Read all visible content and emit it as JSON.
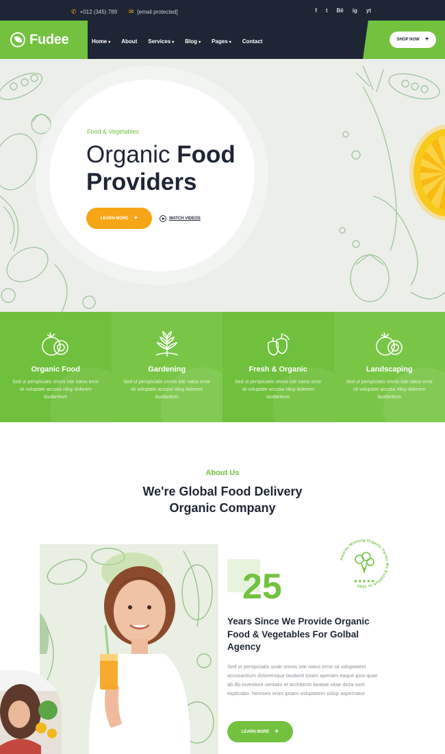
{
  "topbar": {
    "phone": "+012 (345) 789",
    "email": "[email protected]",
    "social": [
      "f",
      "t",
      "Bē",
      "ig",
      "yt"
    ]
  },
  "brand": {
    "name": "Fudee"
  },
  "nav": {
    "items": [
      {
        "label": "Home",
        "dropdown": true
      },
      {
        "label": "About",
        "dropdown": false
      },
      {
        "label": "Services",
        "dropdown": true
      },
      {
        "label": "Blog",
        "dropdown": true
      },
      {
        "label": "Pages",
        "dropdown": true
      },
      {
        "label": "Contact",
        "dropdown": false
      }
    ],
    "shop_label": "SHOP NOW"
  },
  "hero": {
    "subtitle": "Food & Vegetables",
    "title_light": "Organic ",
    "title_bold_1": "Food",
    "title_bold_2": "Providers",
    "learn_label": "LEARN MORE",
    "watch_label": "WATCH VIDEOS"
  },
  "features": [
    {
      "title": "Organic Food",
      "desc": "Sed ut perspiciatis omnis iste natus error sit voluptate accusa ntiuy dolorem laudantium",
      "icon": "tomato-icon"
    },
    {
      "title": "Gardening",
      "desc": "Sed ut perspiciatis omnis iste natus error sit voluptate accusa ntiuy dolorem laudantium",
      "icon": "wheat-icon"
    },
    {
      "title": "Fresh & Organic",
      "desc": "Sed ut perspiciatis omnis iste natus error sit voluptate accusa ntiuy dolorem laudantium",
      "icon": "pepper-icon"
    },
    {
      "title": "Landscaping",
      "desc": "Sed ut perspiciatis omnis iste natus error sit voluptate accusa ntiuy dolorem laudantium",
      "icon": "tomato-icon"
    }
  ],
  "about": {
    "label": "About Us",
    "title_line1": "We're Global Food Delivery",
    "title_line2": "Organic Company",
    "years_number": "25",
    "years_title": "Years Since We Provide Organic Food & Vegetables For Golbal Agency",
    "text": "Sed ut perspiciatis unde omnis iste natus error sit voluptatem accusantium doloremque laudanti totam aperiam eaque ipsa quae ab illo inventore veritatis et architecto beatae vitae dicta sunt explicabo. Nemoes enim ipsam voluptatem volup aspernatur",
    "learn_label": "LEARN MORE",
    "badge_text": "Awards Winning Organic Farms We Establish In 1990",
    "badge_stars": "★★★★★"
  },
  "colors": {
    "green": "#72c23f",
    "navy": "#1e2635",
    "orange": "#f5a516"
  }
}
